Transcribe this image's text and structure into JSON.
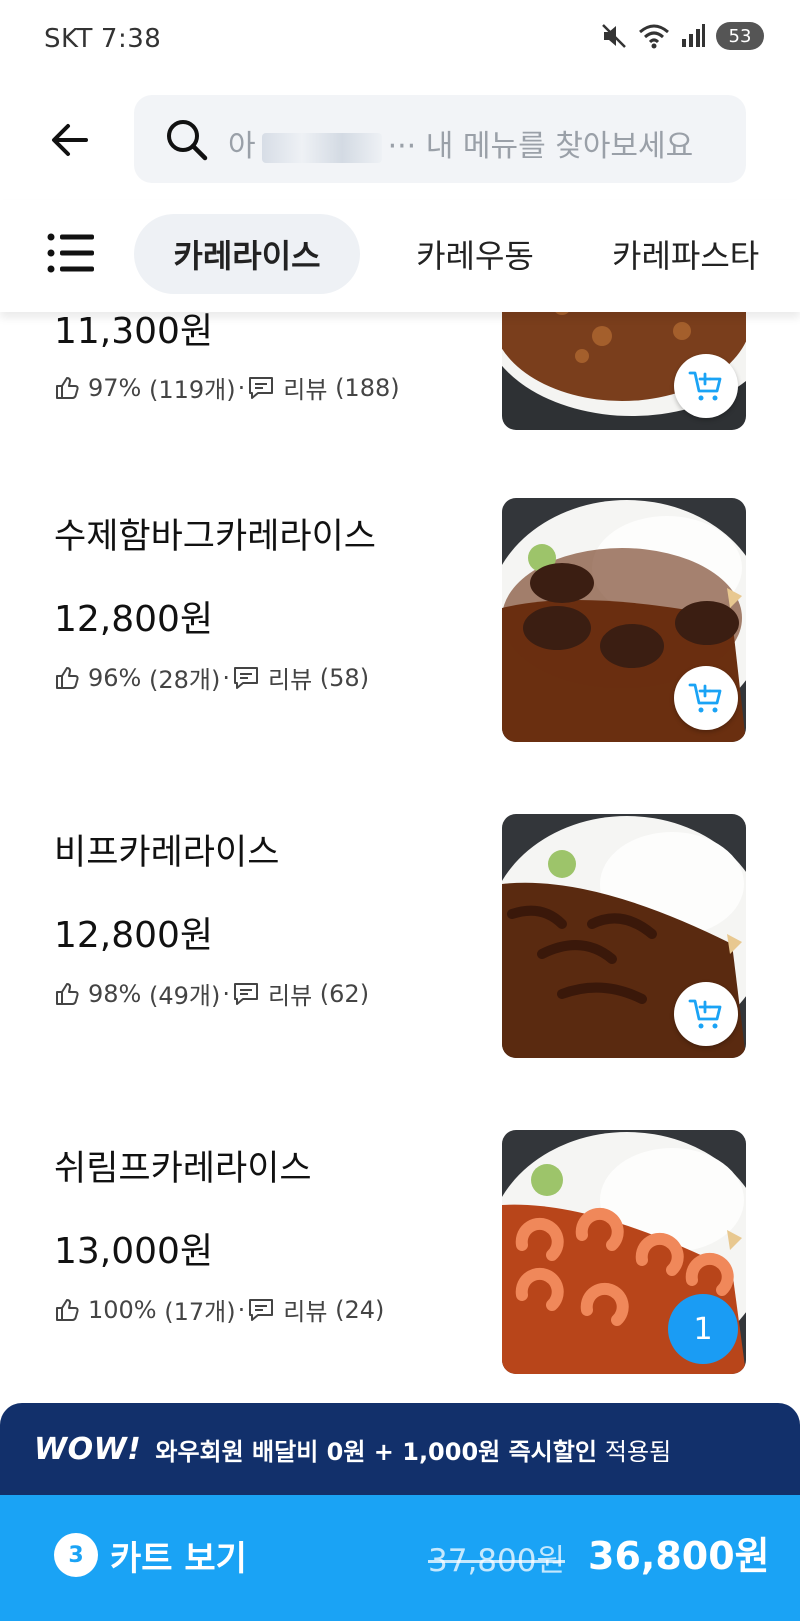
{
  "status_bar": {
    "carrier": "SKT",
    "time": "7:38",
    "battery": "53"
  },
  "search": {
    "placeholder": "아··· 내 메뉴를 찾아보세요",
    "placeholder_start": "아",
    "placeholder_end": "··· 내 메뉴를 찾아보세요"
  },
  "tabs": [
    {
      "label": "카레라이스",
      "active": true
    },
    {
      "label": "카레우동",
      "active": false
    },
    {
      "label": "카레파스타",
      "active": false
    }
  ],
  "items": [
    {
      "name": "",
      "price": "11,300원",
      "like_pct": "97%",
      "like_count": "(119개)",
      "review_label": "리뷰",
      "review_count": "(188)",
      "action": "add"
    },
    {
      "name": "수제함바그카레라이스",
      "price": "12,800원",
      "like_pct": "96%",
      "like_count": "(28개)",
      "review_label": "리뷰",
      "review_count": "(58)",
      "action": "add"
    },
    {
      "name": "비프카레라이스",
      "price": "12,800원",
      "like_pct": "98%",
      "like_count": "(49개)",
      "review_label": "리뷰",
      "review_count": "(62)",
      "action": "add"
    },
    {
      "name": "쉬림프카레라이스",
      "price": "13,000원",
      "like_pct": "100%",
      "like_count": "(17개)",
      "review_label": "리뷰",
      "review_count": "(24)",
      "action": "quantity",
      "quantity": "1"
    }
  ],
  "wow_banner": {
    "logo": "WOW!",
    "text": "와우회원 배달비 0원 + 1,000원 즉시할인",
    "applied": "적용됨"
  },
  "cart": {
    "count": "3",
    "label": "카트 보기",
    "original_price": "37,800원",
    "total_price": "36,800원"
  },
  "colors": {
    "accent": "#1aa3f5",
    "wow_bg": "#12306b",
    "search_bg": "#f2f4f7"
  }
}
